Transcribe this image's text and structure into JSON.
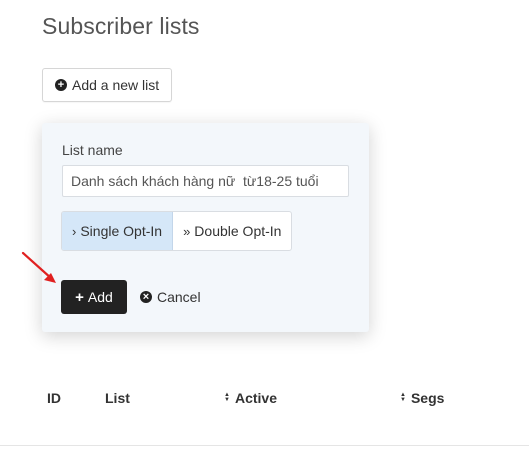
{
  "page": {
    "title": "Subscriber lists"
  },
  "toolbar": {
    "add_list_label": "Add a new list",
    "add_list_icon": "plus-circle-icon"
  },
  "new_list_form": {
    "name_label": "List name",
    "name_value": "Danh sách khách hàng nữ  từ18-25 tuổi",
    "optin_options": [
      {
        "label": "Single Opt-In",
        "selected": true,
        "icon": "chevron-right-icon"
      },
      {
        "label": "Double Opt-In",
        "selected": false,
        "icon": "double-chevron-right-icon"
      }
    ],
    "add_label": "Add",
    "cancel_label": "Cancel"
  },
  "table": {
    "columns": [
      {
        "label": "ID",
        "sortable": false
      },
      {
        "label": "List",
        "sortable": false
      },
      {
        "label": "Active",
        "sortable": true
      },
      {
        "label": "Segs",
        "sortable": true
      }
    ]
  },
  "colors": {
    "primary_button": "#222222",
    "selected_option": "#d5e7f8",
    "popover_bg": "#f3f7fb",
    "annotation_arrow": "#e02020"
  }
}
